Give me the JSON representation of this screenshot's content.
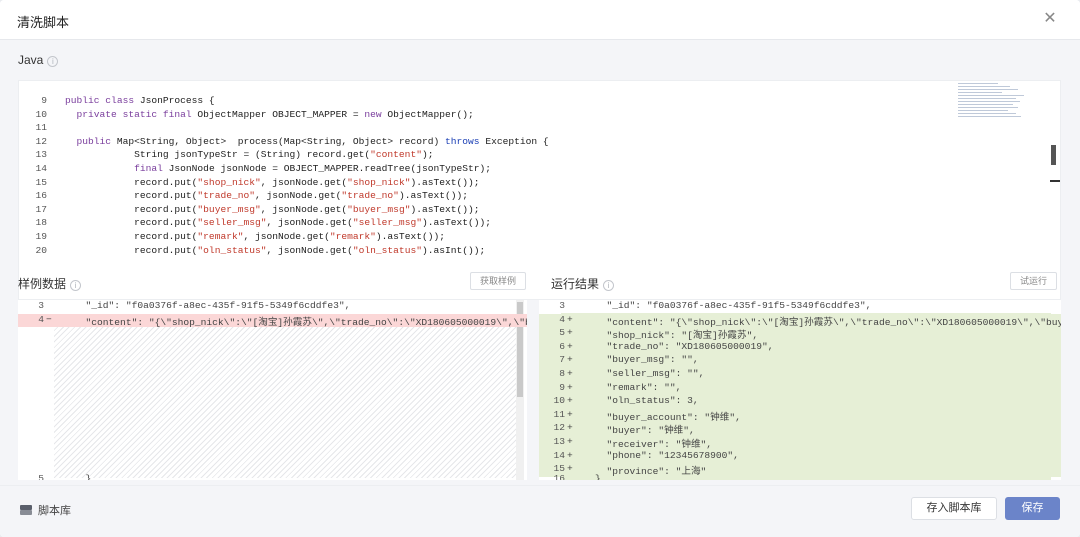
{
  "dialog": {
    "title": "清洗脚本",
    "close_icon": "close-icon"
  },
  "editor": {
    "language": "Java",
    "lines": [
      {
        "n": "9",
        "segs": [
          [
            "kw",
            "public class "
          ],
          [
            "",
            "JsonProcess {"
          ]
        ]
      },
      {
        "n": "10",
        "segs": [
          [
            "",
            "  "
          ],
          [
            "kw",
            "private static final "
          ],
          [
            "",
            "ObjectMapper OBJECT_MAPPER = "
          ],
          [
            "kw",
            "new "
          ],
          [
            "",
            "ObjectMapper();"
          ]
        ]
      },
      {
        "n": "11",
        "segs": [
          [
            "",
            ""
          ]
        ]
      },
      {
        "n": "12",
        "segs": [
          [
            "",
            "  "
          ],
          [
            "kw",
            "public "
          ],
          [
            "",
            "Map<String, Object>  process(Map<String, Object> record) "
          ],
          [
            "kw2",
            "throws "
          ],
          [
            "",
            "Exception {"
          ]
        ]
      },
      {
        "n": "13",
        "segs": [
          [
            "",
            "            String jsonTypeStr = (String) record.get("
          ],
          [
            "str",
            "\"content\""
          ],
          [
            "",
            ");"
          ]
        ]
      },
      {
        "n": "14",
        "segs": [
          [
            "",
            "            "
          ],
          [
            "kw",
            "final "
          ],
          [
            "",
            "JsonNode jsonNode = OBJECT_MAPPER.readTree(jsonTypeStr);"
          ]
        ]
      },
      {
        "n": "15",
        "segs": [
          [
            "",
            "            record.put("
          ],
          [
            "str",
            "\"shop_nick\""
          ],
          [
            "",
            ", jsonNode.get("
          ],
          [
            "str",
            "\"shop_nick\""
          ],
          [
            "",
            ").asText());"
          ]
        ]
      },
      {
        "n": "16",
        "segs": [
          [
            "",
            "            record.put("
          ],
          [
            "str",
            "\"trade_no\""
          ],
          [
            "",
            ", jsonNode.get("
          ],
          [
            "str",
            "\"trade_no\""
          ],
          [
            "",
            ").asText());"
          ]
        ]
      },
      {
        "n": "17",
        "segs": [
          [
            "",
            "            record.put("
          ],
          [
            "str",
            "\"buyer_msg\""
          ],
          [
            "",
            ", jsonNode.get("
          ],
          [
            "str",
            "\"buyer_msg\""
          ],
          [
            "",
            ").asText());"
          ]
        ]
      },
      {
        "n": "18",
        "segs": [
          [
            "",
            "            record.put("
          ],
          [
            "str",
            "\"seller_msg\""
          ],
          [
            "",
            ", jsonNode.get("
          ],
          [
            "str",
            "\"seller_msg\""
          ],
          [
            "",
            ").asText());"
          ]
        ]
      },
      {
        "n": "19",
        "segs": [
          [
            "",
            "            record.put("
          ],
          [
            "str",
            "\"remark\""
          ],
          [
            "",
            ", jsonNode.get("
          ],
          [
            "str",
            "\"remark\""
          ],
          [
            "",
            ").asText());"
          ]
        ]
      },
      {
        "n": "20",
        "segs": [
          [
            "",
            "            record.put("
          ],
          [
            "str",
            "\"oln_status\""
          ],
          [
            "",
            ", jsonNode.get("
          ],
          [
            "str",
            "\"oln_status\""
          ],
          [
            "",
            ").asInt());"
          ]
        ]
      }
    ]
  },
  "sample": {
    "label": "样例数据",
    "button": "获取样例",
    "rows": [
      {
        "n": "3",
        "mark": "",
        "type": "",
        "text": "  \"_id\": \"f0a0376f-a8ec-435f-91f5-5349f6cddfe3\","
      },
      {
        "n": "4",
        "mark": "−",
        "type": "del",
        "text": "  \"content\": \"{\\\"shop_nick\\\":\\\"[淘宝]孙霞苏\\\",\\\"trade_no\\\":\\\"XD180605000019\\\",\\\"buyer_"
      },
      {
        "n": "5",
        "mark": "",
        "type": "",
        "text": "  }"
      }
    ]
  },
  "result": {
    "label": "运行结果",
    "button": "试运行",
    "rows": [
      {
        "n": "3",
        "mark": "",
        "type": "",
        "text": "  \"_id\": \"f0a0376f-a8ec-435f-91f5-5349f6cddfe3\","
      },
      {
        "n": "4",
        "mark": "+",
        "type": "add",
        "text": "  \"content\": \"{\\\"shop_nick\\\":\\\"[淘宝]孙霞苏\\\",\\\"trade_no\\\":\\\"XD180605000019\\\",\\\"buyer_"
      },
      {
        "n": "5",
        "mark": "+",
        "type": "add",
        "text": "  \"shop_nick\": \"[淘宝]孙霞苏\","
      },
      {
        "n": "6",
        "mark": "+",
        "type": "add",
        "text": "  \"trade_no\": \"XD180605000019\","
      },
      {
        "n": "7",
        "mark": "+",
        "type": "add",
        "text": "  \"buyer_msg\": \"\","
      },
      {
        "n": "8",
        "mark": "+",
        "type": "add",
        "text": "  \"seller_msg\": \"\","
      },
      {
        "n": "9",
        "mark": "+",
        "type": "add",
        "text": "  \"remark\": \"\","
      },
      {
        "n": "10",
        "mark": "+",
        "type": "add",
        "text": "  \"oln_status\": 3,"
      },
      {
        "n": "11",
        "mark": "+",
        "type": "add",
        "text": "  \"buyer_account\": \"钟维\","
      },
      {
        "n": "12",
        "mark": "+",
        "type": "add",
        "text": "  \"buyer\": \"钟维\","
      },
      {
        "n": "13",
        "mark": "+",
        "type": "add",
        "text": "  \"receiver\": \"钟维\","
      },
      {
        "n": "14",
        "mark": "+",
        "type": "add",
        "text": "  \"phone\": \"12345678900\","
      },
      {
        "n": "15",
        "mark": "+",
        "type": "add",
        "text": "  \"province\": \"上海\""
      },
      {
        "n": "16",
        "mark": "",
        "type": "",
        "text": "}"
      }
    ]
  },
  "footer": {
    "library_label": "脚本库",
    "save_to_library": "存入脚本库",
    "save": "保存"
  },
  "colors": {
    "primary": "#6b84c9",
    "deleted_line": "#fbd7d7",
    "added_line": "#e6efd6"
  }
}
